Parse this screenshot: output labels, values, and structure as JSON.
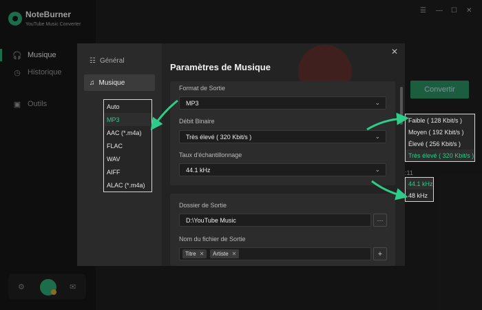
{
  "app": {
    "name": "NoteBurner",
    "subtitle": "YouTube Music Converter"
  },
  "sidebar": {
    "items": [
      {
        "label": "Musique",
        "icon": "headphones-icon",
        "active": true
      },
      {
        "label": "Historique",
        "icon": "clock-icon",
        "active": false
      },
      {
        "label": "Outils",
        "icon": "toolbox-icon",
        "active": false
      }
    ]
  },
  "background": {
    "convert_label": "Convertir",
    "time_text": ":11"
  },
  "settings": {
    "title": "Paramètres de Musique",
    "tabs": [
      {
        "label": "Général",
        "icon": "sliders-icon",
        "active": false
      },
      {
        "label": "Musique",
        "icon": "music-note-icon",
        "active": true
      }
    ],
    "format": {
      "label": "Format de Sortie",
      "value": "MP3"
    },
    "bitrate": {
      "label": "Débit Binaire",
      "value": "Très élevé ( 320 Kbit/s )"
    },
    "samplerate": {
      "label": "Taux d'échantillonnage",
      "value": "44.1 kHz"
    },
    "output_folder": {
      "label": "Dossier de Sortie",
      "value": "D:\\YouTube Music",
      "browse": "···"
    },
    "filename": {
      "label": "Nom du fichier de Sortie",
      "tags": [
        "Titre",
        "Artiste"
      ],
      "add": "+"
    }
  },
  "format_options": [
    "Auto",
    "MP3",
    "AAC (*.m4a)",
    "FLAC",
    "WAV",
    "AIFF",
    "ALAC (*.m4a)"
  ],
  "format_selected": 1,
  "bitrate_options": [
    "Faible ( 128 Kbit/s )",
    "Moyen ( 192 Kbit/s )",
    "Élevé ( 256 Kbit/s )",
    "Très élevé ( 320 Kbit/s )"
  ],
  "bitrate_selected": 3,
  "samplerate_options": [
    "44.1 kHz",
    "48 kHz"
  ],
  "samplerate_selected": 0,
  "colors": {
    "accent": "#2ecc88",
    "brand": "#2aa876"
  }
}
